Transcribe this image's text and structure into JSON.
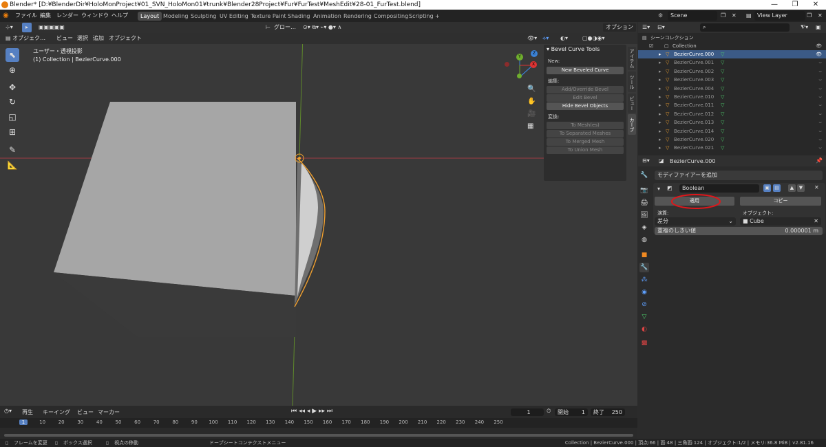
{
  "window": {
    "title": "Blender* [D:¥BlenderDir¥HoloMonProject¥01_SVN_HoloMon01¥trunk¥Blender28Project¥Fur¥FurTest¥MeshEdit¥28-01_FurTest.blend]",
    "min": "—",
    "max": "❐",
    "close": "✕"
  },
  "menus": [
    "ファイル",
    "編集",
    "レンダー",
    "ウィンドウ",
    "ヘルプ"
  ],
  "workspaces": [
    "Layout",
    "Modeling",
    "Sculpting",
    "UV Editing",
    "Texture Paint",
    "Shading",
    "Animation",
    "Rendering",
    "Compositing",
    "Scripting",
    "+"
  ],
  "scene": {
    "label": "Scene",
    "view_layer": "View Layer"
  },
  "viewport": {
    "header_items": [
      "オブジェク…",
      "ビュー",
      "選択",
      "追加",
      "オブジェクト"
    ],
    "orientation": "グロー…",
    "options": "オプション",
    "overlay_text": "ユーザー・透視投影",
    "overlay_sub": "(1) Collection | BezierCurve.000",
    "gizmo": {
      "x": "X",
      "y": "Y",
      "z": "Z"
    }
  },
  "npanel": {
    "title": "Bevel Curve Tools",
    "new_label": "New:",
    "new_btn": "New Beveled Curve",
    "edit_label": "編集:",
    "edit_btns": [
      "Add/Override Bevel",
      "Edit Bevel",
      "Hide Bevel Objects"
    ],
    "convert_label": "変換:",
    "convert_btns": [
      "To Mesh(es)",
      "To Separated Meshes",
      "To Merged Mesh",
      "To Union Mesh"
    ],
    "tabs": [
      "アイテム",
      "ツール",
      "ビュー",
      "カーブ"
    ]
  },
  "timeline": {
    "menus": [
      "再生",
      "キーイング",
      "ビュー",
      "マーカー"
    ],
    "current_frame": "1",
    "start_label": "開始",
    "start": "1",
    "end_label": "終了",
    "end": "250",
    "ticks": [
      "1",
      "10",
      "20",
      "30",
      "40",
      "50",
      "60",
      "70",
      "80",
      "90",
      "100",
      "110",
      "120",
      "130",
      "140",
      "150",
      "160",
      "170",
      "180",
      "190",
      "200",
      "210",
      "220",
      "230",
      "240",
      "250"
    ]
  },
  "status": {
    "left": [
      "フレームを変更",
      "ボックス選択",
      "視点の移動",
      "ドープシートコンテクストメニュー"
    ],
    "right": "Collection | BezierCurve.000 | 頂点:66 | 面:48 | 三角面:124 | オブジェクト:1/2 | メモリ:36.8 MiB | v2.81.16"
  },
  "outliner": {
    "root": "シーンコレクション",
    "collection": "Collection",
    "items": [
      "BezierCurve.000",
      "BezierCurve.001",
      "BezierCurve.002",
      "BezierCurve.003",
      "BezierCurve.004",
      "BezierCurve.010",
      "BezierCurve.011",
      "BezierCurve.012",
      "BezierCurve.013",
      "BezierCurve.014",
      "BezierCurve.020",
      "BezierCurve.021"
    ]
  },
  "properties": {
    "object": "BezierCurve.000",
    "add_modifier": "モディファイアーを追加",
    "modifier_name": "Boolean",
    "apply": "適用",
    "copy": "コピー",
    "operation_label": "演算:",
    "operation": "差分",
    "object_label": "オブジェクト:",
    "object_value": "Cube",
    "threshold_label": "重複のしきい値",
    "threshold": "0.000001 m"
  },
  "colors": {
    "accent": "#5680c2",
    "selection": "#3b5a86",
    "curve": "#f0a030",
    "annotation": "#e0161a"
  }
}
